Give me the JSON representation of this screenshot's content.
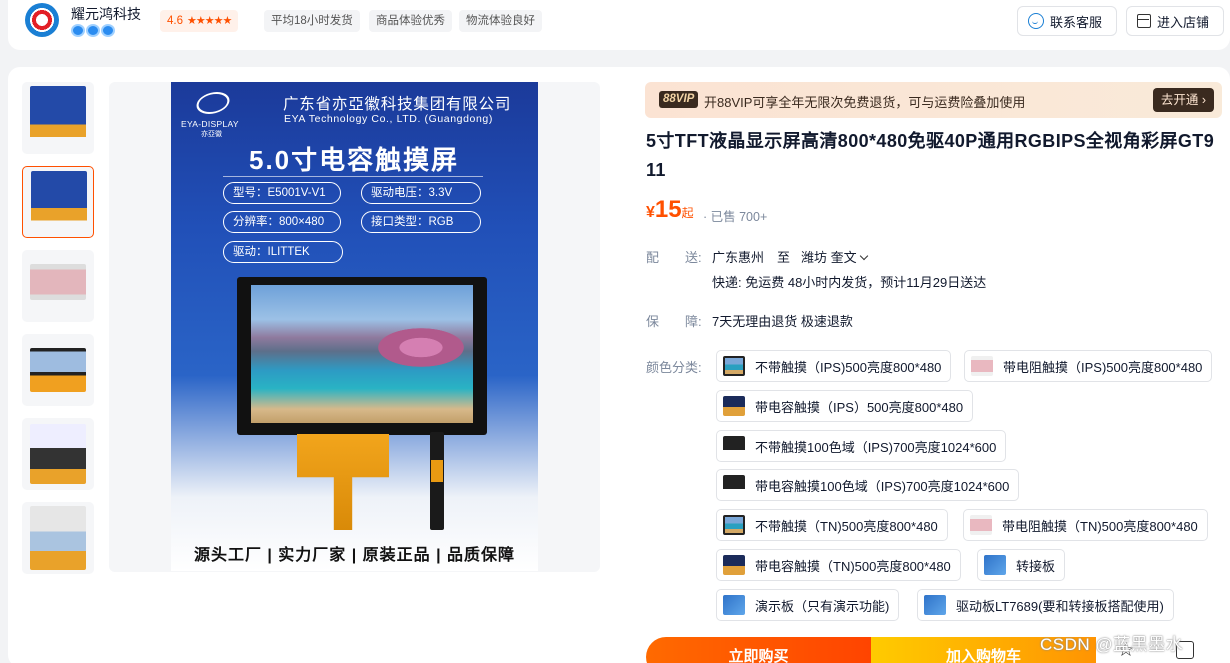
{
  "shop": {
    "name": "耀元鸿科技",
    "rating": "4.6",
    "tags": [
      "平均18小时发货",
      "商品体验优秀",
      "物流体验良好"
    ],
    "service_button": "联系客服",
    "store_button": "进入店铺"
  },
  "hero": {
    "brand_en": "EYA-DISPLAY",
    "brand_cn": "亦亞徽",
    "company_cn": "广东省亦亞徽科技集团有限公司",
    "company_en": "EYA Technology Co., LTD. (Guangdong)",
    "headline": "5.0寸电容触摸屏",
    "specs": [
      "型号：E5001V-V1",
      "驱动电压：3.3V",
      "分辨率：800×480",
      "接口类型：RGB",
      "驱动：ILITTEK"
    ],
    "slogan": "源头工厂 | 实力厂家 | 原装正品 | 品质保障"
  },
  "vip": {
    "badge": "88VIP",
    "text": "开88VIP可享全年无限次免费退货，可与运费险叠加使用",
    "button": "去开通"
  },
  "product": {
    "title": "5寸TFT液晶显示屏高清800*480免驱40P通用RGBIPS全视角彩屏GT911",
    "currency": "¥",
    "price": "15",
    "price_suffix": "起",
    "sold": "· 已售 700+"
  },
  "shipping": {
    "label": "配　　送:",
    "from": "广东惠州",
    "to_word": "至",
    "to": "潍坊 奎文",
    "detail": "快递: 免运费  48小时内发货，预计11月29日送达"
  },
  "guarantee": {
    "label": "保　　障:",
    "value": "7天无理由退货 极速退款"
  },
  "variants": {
    "label": "颜色分类:",
    "options": [
      {
        "label": "不带触摸（IPS)500亮度800*480",
        "icon": "screen-thumb"
      },
      {
        "label": "带电阻触摸（IPS)500亮度800*480",
        "icon": "screen-thumb"
      },
      {
        "label": "带电容触摸（IPS）500亮度800*480",
        "icon": "screen-thumb"
      },
      {
        "label": "不带触摸100色域（IPS)700亮度1024*600",
        "icon": "screen-thumb"
      },
      {
        "label": "带电容触摸100色域（IPS)700亮度1024*600",
        "icon": "screen-thumb"
      },
      {
        "label": "不带触摸（TN)500亮度800*480",
        "icon": "screen-thumb"
      },
      {
        "label": "带电阻触摸（TN)500亮度800*480",
        "icon": "screen-thumb"
      },
      {
        "label": "带电容触摸（TN)500亮度800*480",
        "icon": "screen-thumb"
      },
      {
        "label": "转接板",
        "icon": "board-thumb"
      },
      {
        "label": "演示板（只有演示功能)",
        "icon": "board-thumb"
      },
      {
        "label": "驱动板LT7689(要和转接板搭配使用)",
        "icon": "board-thumb"
      }
    ]
  },
  "actions": {
    "buy": "立即购买",
    "cart": "加入购物车"
  },
  "watermark": "CSDN @蓝黑墨水",
  "colors": {
    "accent": "#ff5000",
    "buy_gradient": [
      "#ff6a00",
      "#ff4400"
    ],
    "cart_gradient": [
      "#ffcb00",
      "#ff9402"
    ],
    "hero_blue": "#2150b8"
  }
}
